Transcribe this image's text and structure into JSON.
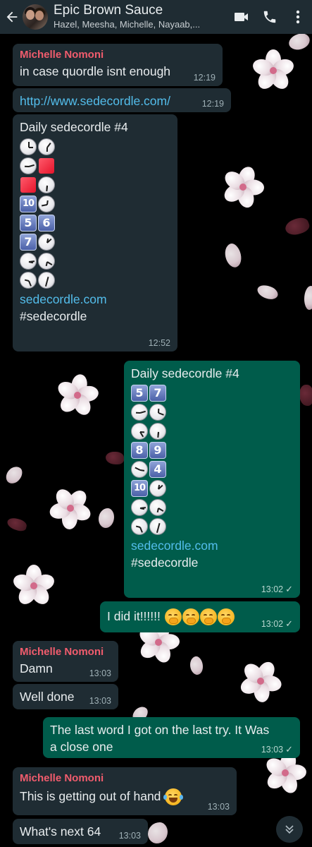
{
  "header": {
    "title": "Epic Brown Sauce",
    "subtitle": "Hazel, Meesha, Michelle, Nayaab,...",
    "icons": [
      "back-arrow-icon",
      "video-call-icon",
      "phone-icon",
      "more-options-icon"
    ]
  },
  "colors": {
    "header_bg": "#1f2c33",
    "incoming_bubble": "#1f2c33",
    "outgoing_bubble": "#005c4b",
    "sender_name": "#f15c6d",
    "link": "#53bdeb"
  },
  "messages": [
    {
      "direction": "in",
      "sender": "Michelle Nomoni",
      "text": "in case quordle isnt enough",
      "time": "12:19"
    },
    {
      "direction": "in",
      "text": "http://www.sedecordle.com/",
      "time": "12:19"
    },
    {
      "direction": "in",
      "title": "Daily sedecordle #4",
      "grid": [
        [
          "clock",
          "clock"
        ],
        [
          "clock",
          "red-square"
        ],
        [
          "red-square",
          "clock"
        ],
        [
          "10",
          "clock"
        ],
        [
          "5",
          "6"
        ],
        [
          "7",
          "clock"
        ],
        [
          "clock",
          "clock"
        ],
        [
          "clock",
          "clock"
        ]
      ],
      "link": "sedecordle.com",
      "hashtag": "#sedecordle",
      "time": "12:52"
    },
    {
      "direction": "out",
      "title": "Daily sedecordle #4",
      "grid": [
        [
          "5",
          "7"
        ],
        [
          "clock",
          "clock"
        ],
        [
          "clock",
          "clock"
        ],
        [
          "8",
          "9"
        ],
        [
          "clock",
          "4"
        ],
        [
          "10",
          "clock"
        ],
        [
          "clock",
          "clock"
        ],
        [
          "clock",
          "clock"
        ]
      ],
      "link": "sedecordle.com",
      "hashtag": "#sedecordle",
      "time": "13:02"
    },
    {
      "direction": "out",
      "text": "I did it!!!!!!",
      "emojis": [
        "hand-over-mouth-face",
        "hand-over-mouth-face",
        "hand-over-mouth-face",
        "hand-over-mouth-face"
      ],
      "time": "13:02"
    },
    {
      "direction": "in",
      "sender": "Michelle Nomoni",
      "text": "Damn",
      "time": "13:03"
    },
    {
      "direction": "in",
      "text": "Well done",
      "time": "13:03"
    },
    {
      "direction": "out",
      "text": "The last word I got on the last try. It Was a close one",
      "line1": "The last word I got on the last try. It Was",
      "line2": "a close one",
      "time": "13:03"
    },
    {
      "direction": "in",
      "sender": "Michelle Nomoni",
      "text": "This is getting out of hand",
      "emojis": [
        "tears-of-joy-face"
      ],
      "time": "13:03"
    },
    {
      "direction": "in",
      "text": "What's next 64",
      "time": "13:03"
    }
  ],
  "scroll_button_icon": "double-chevron-down-icon"
}
